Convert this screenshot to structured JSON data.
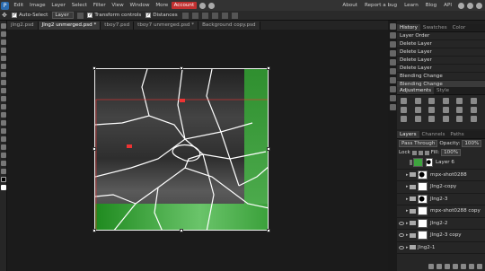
{
  "menubar": {
    "items": [
      "Edit",
      "Image",
      "Layer",
      "Select",
      "Filter",
      "View",
      "Window",
      "More",
      "Account"
    ],
    "right": [
      "About",
      "Report a bug",
      "Learn",
      "Blog",
      "API"
    ]
  },
  "options": {
    "auto_select": "Auto-Select",
    "auto_select_target": "Layer",
    "transform_controls": "Transform controls",
    "distances": "Distances"
  },
  "tabs": [
    "jlng2.psd",
    "Jlng2 unmerged.psd *",
    "tboy7.psd",
    "tboy7 unmerged.psd *",
    "Background copy.psd"
  ],
  "history": {
    "tabs": [
      "History",
      "Swatches",
      "Color"
    ],
    "rows": [
      "Layer Order",
      "Delete Layer",
      "Delete Layer",
      "Delete Layer",
      "Delete Layer",
      "Blending Change",
      "Blending Change"
    ]
  },
  "adjustments": {
    "tabs": [
      "Adjustments",
      "Style"
    ]
  },
  "layers": {
    "tabs": [
      "Layers",
      "Channels",
      "Paths"
    ],
    "blend_mode": "Pass Through",
    "opacity_label": "Opacity:",
    "opacity_value": "100%",
    "lock_label": "Lock",
    "fill_label": "Fill:",
    "fill_value": "100%",
    "rows": [
      {
        "name": "Layer 6",
        "eye": false,
        "group": false,
        "thumb": "green"
      },
      {
        "name": "mpx-shot0288",
        "eye": false,
        "group": true,
        "thumb": "black"
      },
      {
        "name": "Jlng2-copy",
        "eye": false,
        "group": true,
        "thumb": "white"
      },
      {
        "name": "Jlng2-3",
        "eye": false,
        "group": true,
        "thumb": "black"
      },
      {
        "name": "mpx-shot0288 copy",
        "eye": false,
        "group": true,
        "thumb": "white"
      },
      {
        "name": "Jlng2-2",
        "eye": true,
        "group": true,
        "thumb": "white"
      },
      {
        "name": "Jlng2-3 copy",
        "eye": true,
        "group": true,
        "thumb": "white"
      },
      {
        "name": "Jlng2-1",
        "eye": true,
        "group": true,
        "thumb": "white"
      }
    ]
  },
  "colors": {
    "accent_red": "#c23030",
    "green": "#3ea33e"
  }
}
